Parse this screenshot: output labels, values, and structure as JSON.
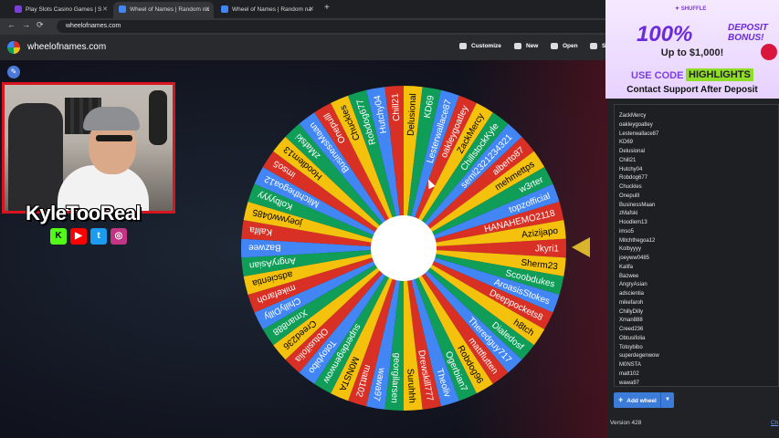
{
  "browser": {
    "tabs": [
      {
        "title": "Play Slots Casino Games | S",
        "color": "#7a3fd6"
      },
      {
        "title": "Wheel of Names | Random na",
        "color": "#4285f4"
      },
      {
        "title": "Wheel of Names | Random na",
        "color": "#4285f4"
      }
    ],
    "new_tab": "+",
    "nav": {
      "back": "←",
      "forward": "→",
      "reload": "⟳"
    },
    "url": "wheelofnames.com"
  },
  "header": {
    "brand": "wheelofnames.com",
    "buttons": {
      "customize": "Customize",
      "new": "New",
      "open": "Open",
      "save": "S"
    }
  },
  "stream": {
    "name": "KyleTooReal",
    "socials": [
      {
        "label": "K",
        "color": "#53fc18"
      },
      {
        "label": "▶",
        "color": "#ff0000"
      },
      {
        "label": "t",
        "color": "#1d9bf0"
      },
      {
        "label": "◎",
        "color": "#c13584"
      }
    ]
  },
  "ad": {
    "brand": "✦ SHUFFLE",
    "headline": "100%",
    "headline2": "DEPOSIT BONUS!",
    "upto": "Up to $1,000!",
    "use_code": "USE CODE",
    "code": "HIGHLIGHTS",
    "contact": "Contact Support After Deposit"
  },
  "wheel": {
    "colors": [
      "#d93025",
      "#f4c20d",
      "#0f9d58",
      "#4285f4"
    ],
    "pointer_color": "#d8b52a",
    "labels": [
      "Jkyri1",
      "Sherm23",
      "Scoobdukes",
      "AroasisStokes",
      "Deeppockets8",
      "h8tch",
      "Dialedosf",
      "Theredguy717",
      "mattflutten",
      "Robdog96",
      "Ogerbian7",
      "Theoliv",
      "Drewskill777",
      "Suruhhh",
      "georgilarsen",
      "wawa97",
      "matt102",
      "M0NSTA",
      "superdegenwow",
      "Totoybibo",
      "Obtusifolia",
      "Creed236",
      "Xman888",
      "ChillyDilly",
      "mikefaroh",
      "adscientia",
      "AngryAsian",
      "Bazwee",
      "Kalifa",
      "joeyww0485",
      "Kolbyyyy",
      "Mitchthegoa12",
      "imso5",
      "Hoodlem13",
      "zMafski",
      "BusinessMaan",
      "Onepulll",
      "Chuckles",
      "Robdog677",
      "Hutchy04",
      "Chill21",
      "Delusional",
      "KD69",
      "Lesterwallace87",
      "oakleygoatley",
      "ZackMercy",
      "ChillstockKyle",
      "seml2321234321",
      "alberto87",
      "mehmettps",
      "w3rter",
      "topzofficial",
      "HANAHEMO2118",
      "Azizijapo"
    ]
  },
  "entries": {
    "names": [
      "ZackMercy",
      "oakleygoatley",
      "Lesterwallace87",
      "KD69",
      "Delusional",
      "Chill21",
      "Hutchy04",
      "Robdog677",
      "Chuckles",
      "Onepulll",
      "BusinessMaan",
      "zMafski",
      "Hoodlem13",
      "imso5",
      "Mitchthegoa12",
      "Kolbyyyy",
      "joeyww0485",
      "Kalifa",
      "Bazwee",
      "AngryAsian",
      "adscientia",
      "mikefaroh",
      "ChillyDilly",
      "Xman888",
      "Creed236",
      "Obtusifolia",
      "Totoybibo",
      "superdegenwow",
      "M0NSTA",
      "matt102",
      "wawa97"
    ],
    "add_wheel": "Add wheel",
    "version": "Version 428",
    "link": "Ch"
  }
}
